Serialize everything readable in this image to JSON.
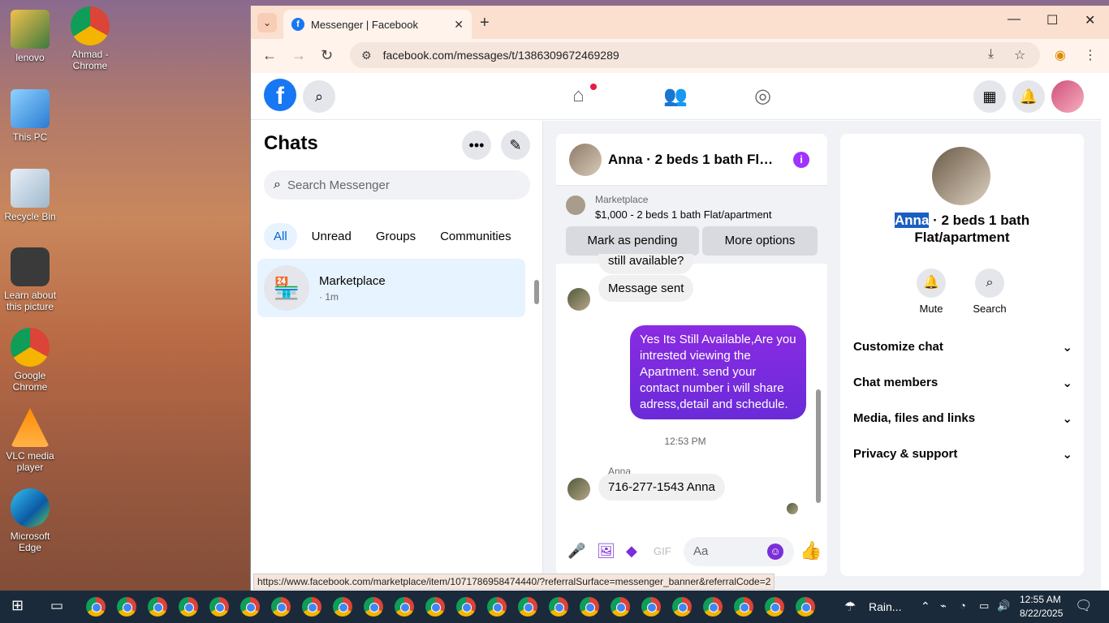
{
  "desktop": {
    "icons": [
      {
        "label": "lenovo"
      },
      {
        "label": "Ahmad - Chrome"
      },
      {
        "label": "This PC"
      },
      {
        "label": "Recycle Bin"
      },
      {
        "label": "Learn about this picture"
      },
      {
        "label": "Google Chrome"
      },
      {
        "label": "VLC media player"
      },
      {
        "label": "Microsoft Edge"
      }
    ]
  },
  "browser": {
    "tab_title": "Messenger | Facebook",
    "url": "facebook.com/messages/t/1386309672469289",
    "status_url": "https://www.facebook.com/marketplace/item/1071786958474440/?referralSurface=messenger_banner&referralCode=2"
  },
  "chats": {
    "title": "Chats",
    "search_placeholder": "Search Messenger",
    "filters": [
      "All",
      "Unread",
      "Groups",
      "Communities"
    ],
    "items": [
      {
        "name": "Marketplace",
        "meta": "· 1m"
      }
    ]
  },
  "conversation": {
    "title": "Anna · 2 beds 1 bath Flat/apartment",
    "banner_label": "Marketplace",
    "banner_item": "$1,000 - 2 beds 1 bath Flat/apartment",
    "btn_pending": "Mark as pending",
    "btn_more": "More options",
    "messages": {
      "partial": "still available?",
      "sent_notice": "Message sent",
      "outgoing": "Yes Its Still Available,Are you intrested viewing the Apartment. send your contact number i will share adress,detail and schedule.",
      "timestamp": "12:53 PM",
      "sender": "Anna",
      "reply": "716-277-1543 Anna"
    },
    "composer_placeholder": "Aa"
  },
  "info_panel": {
    "name_highlight": "Anna",
    "name_rest": " · 2 beds 1 bath Flat/apartment",
    "actions": [
      "Mute",
      "Search"
    ],
    "sections": [
      "Customize chat",
      "Chat members",
      "Media, files and links",
      "Privacy & support"
    ]
  },
  "taskbar": {
    "weather": "Rain...",
    "time": "12:55 AM",
    "date": "8/22/2025"
  },
  "colors": {
    "fb_blue": "#1877f2",
    "messenger_purple": "#7b2fd8",
    "taskbar": "#1b2a3a"
  }
}
